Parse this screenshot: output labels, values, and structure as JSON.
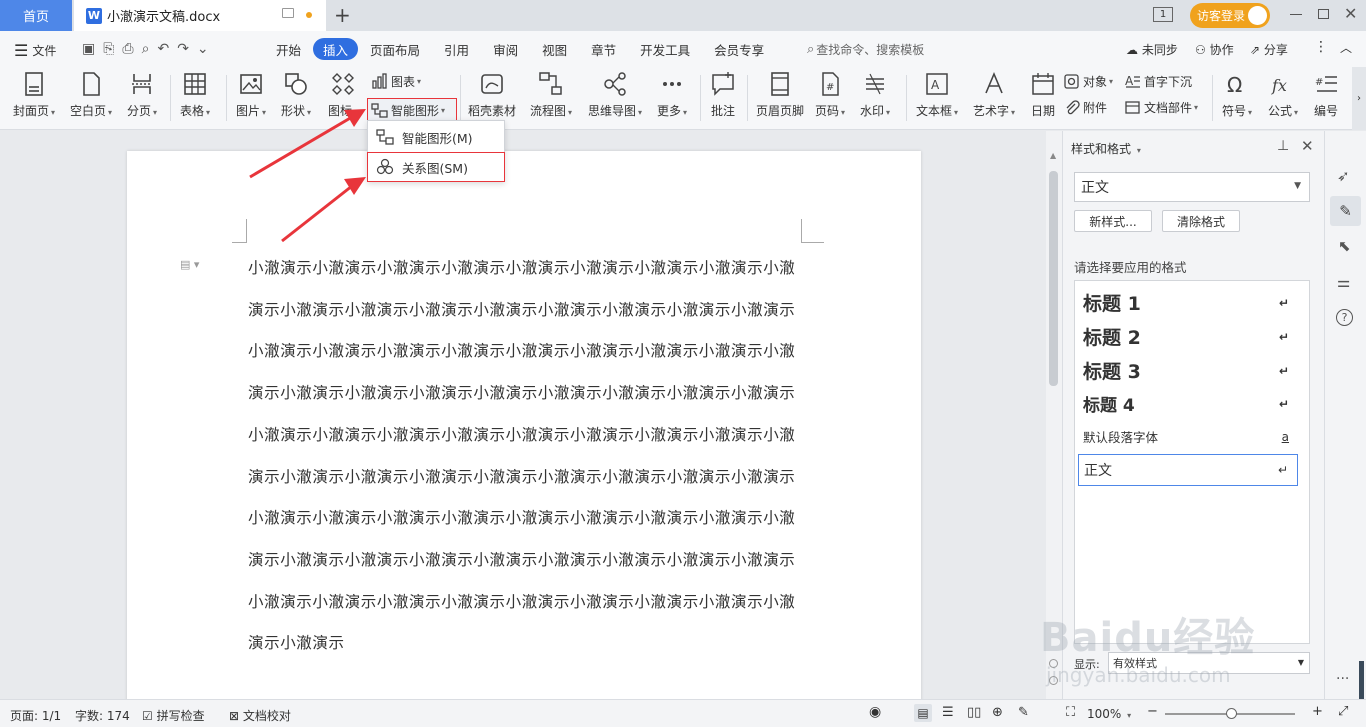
{
  "tabbar": {
    "home": "首页",
    "doc_title": "小澈演示文稿.docx",
    "add": "+",
    "page_count_icon": "1",
    "login": "访客登录"
  },
  "menubar": {
    "file": "文件",
    "tabs": [
      "开始",
      "插入",
      "页面布局",
      "引用",
      "审阅",
      "视图",
      "章节",
      "开发工具",
      "会员专享"
    ],
    "active_tab": "插入",
    "search": "查找命令、搜索模板",
    "sync": "未同步",
    "collab": "协作",
    "share": "分享"
  },
  "ribbon": {
    "cover": "封面页",
    "blank": "空白页",
    "pagebreak": "分页",
    "table": "表格",
    "picture": "图片",
    "shape": "形状",
    "icon": "图标",
    "chart": "图表",
    "smartart": "智能图形",
    "daoke": "稻壳素材",
    "flowchart": "流程图",
    "mindmap": "思维导图",
    "more": "更多",
    "comment": "批注",
    "headerfooter": "页眉页脚",
    "pagenum": "页码",
    "watermark": "水印",
    "textbox": "文本框",
    "wordart": "艺术字",
    "date": "日期",
    "object": "对象",
    "attachment": "附件",
    "dropcap": "首字下沉",
    "docpart": "文档部件",
    "symbol": "符号",
    "formula": "公式",
    "numbering": "编号"
  },
  "dropdown": {
    "item1": "智能图形(M)",
    "item2": "关系图(SM)"
  },
  "document": {
    "body": "小澈演示小澈演示小澈演示小澈演示小澈演示小澈演示小澈演示小澈演示小澈演示小澈演示小澈演示小澈演示小澈演示小澈演示小澈演示小澈演示小澈演示小澈演示小澈演示小澈演示小澈演示小澈演示小澈演示小澈演示小澈演示小澈演示小澈演示小澈演示小澈演示小澈演示小澈演示小澈演示小澈演示小澈演示小澈演示小澈演示小澈演示小澈演示小澈演示小澈演示小澈演示小澈演示小澈演示小澈演示小澈演示小澈演示小澈演示小澈演示小澈演示小澈演示小澈演示小澈演示小澈演示小澈演示小澈演示小澈演示小澈演示小澈演示小澈演示小澈演示小澈演示小澈演示小澈演示小澈演示小澈演示小澈演示小澈演示小澈演示小澈演示小澈演示小澈演示小澈演示小澈演示小澈演示小澈演示小澈演示小澈演示小澈演示"
  },
  "panel": {
    "title": "样式和格式",
    "current_style": "正文",
    "new_style": "新样式...",
    "clear_format": "清除格式",
    "prompt": "请选择要应用的格式",
    "styles": [
      "标题  1",
      "标题  2",
      "标题  3",
      "标题  4",
      "默认段落字体",
      "正文"
    ],
    "show_label": "显示:",
    "show_value": "有效样式"
  },
  "statusbar": {
    "page": "页面: 1/1",
    "words": "字数: 174",
    "spell": "拼写检查",
    "proof": "文档校对",
    "zoom": "100%"
  },
  "watermark": {
    "brand": "Baidu经验",
    "url": "jingyan.baidu.com"
  },
  "colors": {
    "accent": "#2f6ee0",
    "annotation": "#e8353b",
    "login": "#f0a21d"
  }
}
